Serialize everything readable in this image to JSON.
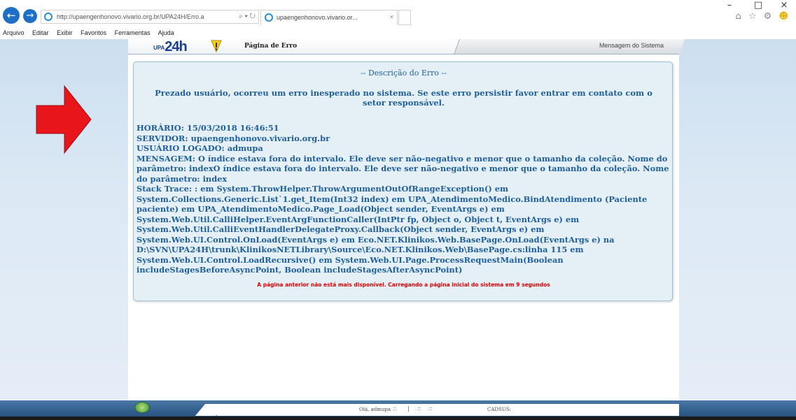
{
  "browser": {
    "address": "http://upaengenhonovo.vivario.org.br/UPA24H/Erro.a",
    "address_controls": "⌕ ▾ ↻",
    "tab_title": "upaengenhonovo.vivario.or...",
    "tab_close": "×",
    "back_glyph": "←",
    "forward_glyph": "→",
    "minimize": "–",
    "restore": "□",
    "close": "×",
    "tools_glyphs": "⌂ ☆ ⚙"
  },
  "menu": {
    "items": [
      "Arquivo",
      "Editar",
      "Exibir",
      "Favoritos",
      "Ferramentas",
      "Ajuda"
    ]
  },
  "header": {
    "logo_small": "UPA",
    "logo_big": "24h",
    "title": "Página de Erro",
    "system_message_tab": "Mensagem do Sistema"
  },
  "error": {
    "heading": "-- Descrição do Erro --",
    "intro": "Prezado usuário, ocorreu um erro inesperado no sistema. Se este erro persistir favor entrar em contato com o setor responsável.",
    "time_label": "HORÁRIO:",
    "time_value": "15/03/2018 16:46:51",
    "server_label": "SERVIDOR:",
    "server_value": "upaengenhonovo.vivario.org.br",
    "user_label": "USUÁRIO LOGADO:",
    "user_value": "admupa",
    "message_label": "MENSAGEM:",
    "message_value": "O índice estava fora do intervalo. Ele deve ser não-negativo e menor que o tamanho da coleção. Nome do parâmetro: indexO índice estava fora do intervalo. Ele deve ser não-negativo e menor que o tamanho da coleção. Nome do parâmetro: index",
    "stack_label": "Stack Trace:",
    "stack_value": ": em System.ThrowHelper.ThrowArgumentOutOfRangeException() em System.Collections.Generic.List`1.get_Item(Int32 index) em UPA_AtendimentoMedico.BindAtendimento (Paciente paciente) em UPA_AtendimentoMedico.Page_Load(Object sender, EventArgs e) em System.Web.Util.CalliHelper.EventArgFunctionCaller(IntPtr fp, Object o, Object t, EventArgs e) em System.Web.Util.CalliEventHandlerDelegateProxy.Callback(Object sender, EventArgs e) em System.Web.UI.Control.OnLoad(EventArgs e) em Eco.NET.Klinikos.Web.BasePage.OnLoad(EventArgs e) na D:\\SVN\\UPA24H\\trunk\\KlinikosNETLibrary\\Source\\Eco.NET.Klinikos.Web\\BasePage.cs:linha 115 em System.Web.UI.Control.LoadRecursive() em System.Web.UI.Page.ProcessRequestMain(Boolean includeStagesBeforeAsyncPoint, Boolean includeStagesAfterAsyncPoint)",
    "redirect_notice": "A página anterior não está mais disponível. Carregando a página inicial do sistema em 9 segundos"
  },
  "footer": {
    "greeting": "Olá, admupa",
    "sep1": "::",
    "sep2": "|",
    "sep3": "::",
    "sep4": "::",
    "cadsus": "CADSUS:"
  },
  "colors": {
    "error_text": "#1f5f9f",
    "redirect_text": "#e00000",
    "arrow": "#e8151b",
    "box_bg": "#e4eff6"
  },
  "icons": [
    "back-icon",
    "forward-icon",
    "ie-icon",
    "warning-icon",
    "red-arrow-icon",
    "globe-icon"
  ]
}
